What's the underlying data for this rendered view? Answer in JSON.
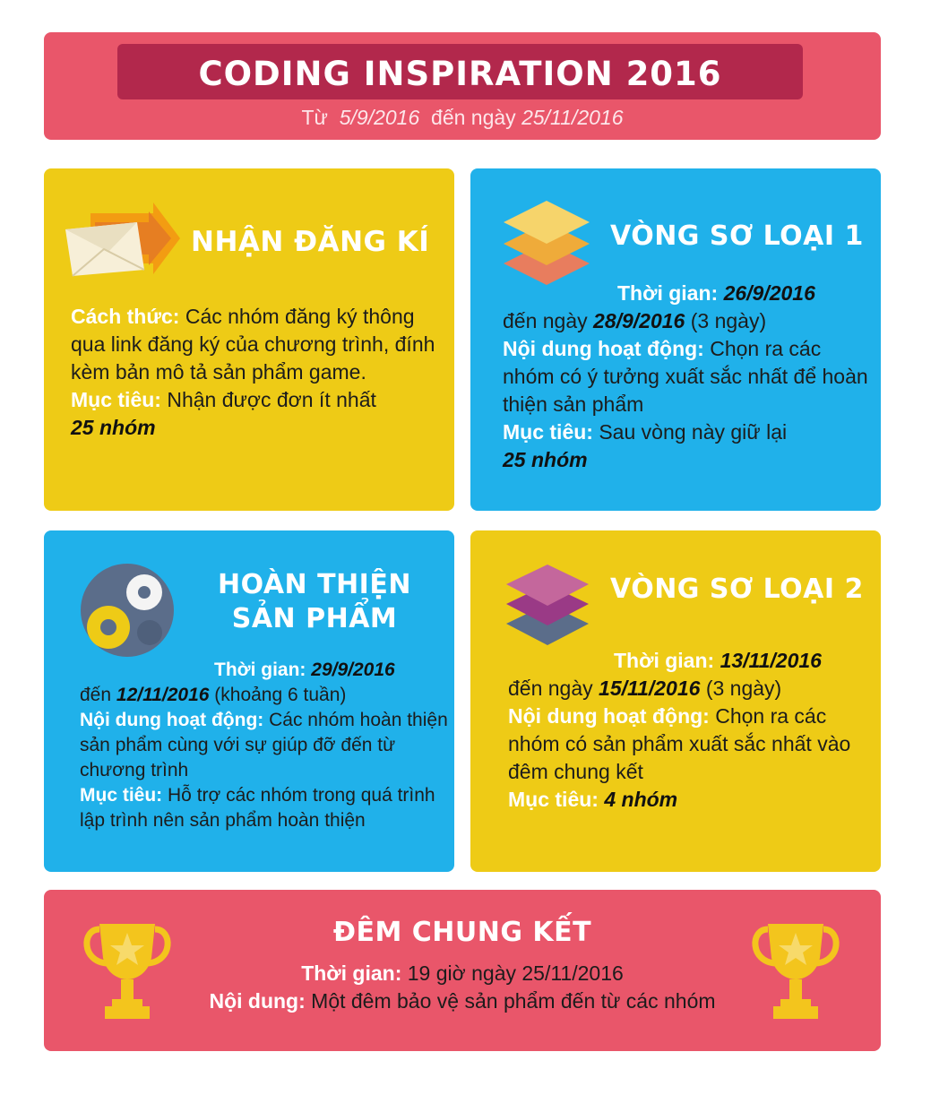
{
  "header": {
    "title": "CODING INSPIRATION 2016",
    "from_word": "Từ",
    "start_date": "5/9/2016",
    "to_word": "đến ngày",
    "end_date": "25/11/2016"
  },
  "cards": [
    {
      "heading": "NHẬN ĐĂNG KÍ",
      "icon": "envelope-arrow-icon",
      "method_label": "Cách thức:",
      "method_text": "Các nhóm đăng ký thông qua link đăng ký của chương trình, đính kèm bản mô tả sản phẩm game.",
      "goal_label": "Mục tiêu:",
      "goal_text": "Nhận được đơn ít nhất",
      "goal_value": "25 nhóm"
    },
    {
      "heading": "VÒNG SƠ LOẠI 1",
      "icon": "layers-icon",
      "time_label": "Thời gian:",
      "time_start": "26/9/2016",
      "time_to": "đến ngày",
      "time_end": "28/9/2016",
      "time_note": "(3 ngày)",
      "content_label": "Nội dung hoạt động:",
      "content_text": "Chọn ra các nhóm có ý tưởng xuất sắc nhất để hoàn thiện sản phẩm",
      "goal_label": "Mục tiêu:",
      "goal_text": "Sau vòng này giữ lại",
      "goal_value": "25 nhóm"
    },
    {
      "heading_line1": "HOÀN THIỆN",
      "heading_line2": "SẢN PHẨM",
      "icon": "gears-icon",
      "time_label": "Thời gian:",
      "time_start": "29/9/2016",
      "time_to": "đến",
      "time_end": "12/11/2016",
      "time_note": "(khoảng 6 tuần)",
      "content_label": "Nội dung hoạt động:",
      "content_text": "Các nhóm hoàn thiện sản phẩm cùng với sự giúp đỡ đến từ chương trình",
      "goal_label": "Mục tiêu:",
      "goal_text": "Hỗ trợ các nhóm trong quá trình lập trình nên sản phẩm hoàn thiện"
    },
    {
      "heading": "VÒNG SƠ LOẠI 2",
      "icon": "layers-icon",
      "time_label": "Thời gian:",
      "time_start": "13/11/2016",
      "time_to": "đến ngày",
      "time_end": "15/11/2016",
      "time_note": "(3 ngày)",
      "content_label": "Nội dung hoạt động:",
      "content_text": "Chọn ra các nhóm có sản phẩm xuất sắc nhất vào đêm chung kết",
      "goal_label": "Mục tiêu:",
      "goal_value": "4 nhóm"
    }
  ],
  "final": {
    "heading": "ĐÊM CHUNG KẾT",
    "time_label": "Thời gian:",
    "time_text": "19 giờ ngày 25/11/2016",
    "content_label": "Nội dung:",
    "content_text": "Một đêm bảo vệ sản phẩm đến từ các nhóm",
    "icon": "trophy-icon"
  },
  "colors": {
    "pink": "#e9566a",
    "dark_pink": "#b2284c",
    "yellow": "#eecb16",
    "blue": "#20b1ea"
  }
}
